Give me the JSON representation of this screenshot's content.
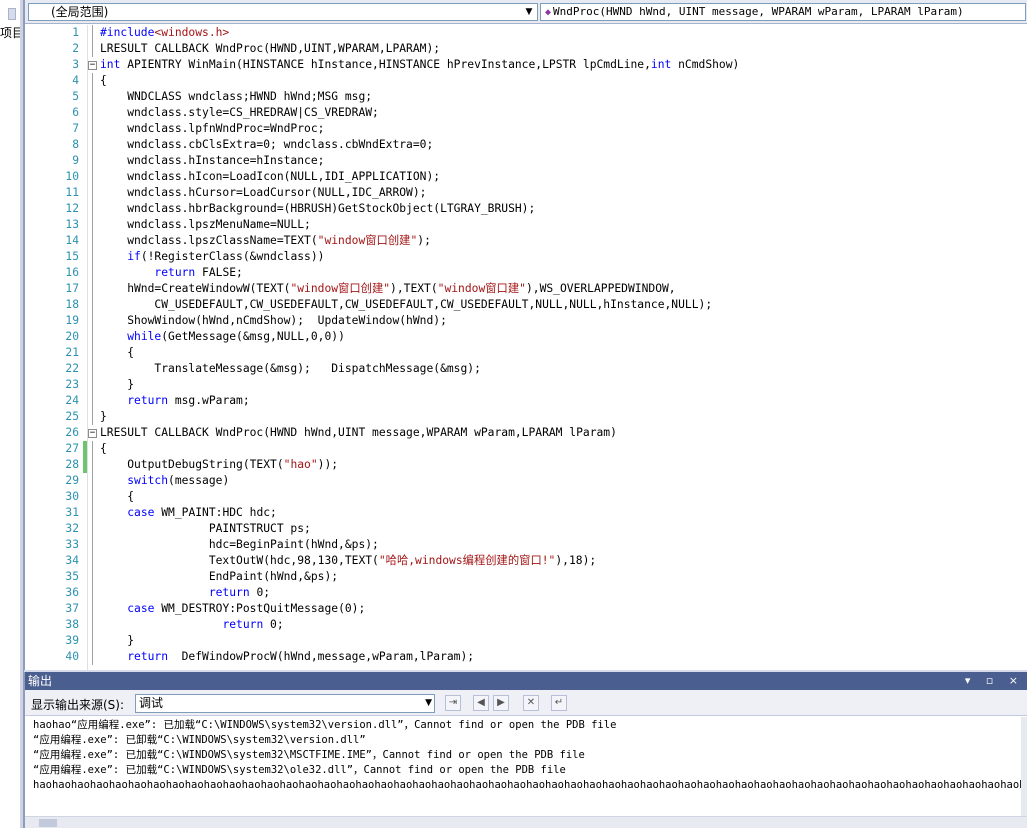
{
  "left_panel": {
    "project_label": "项目"
  },
  "editor": {
    "scope_combo": "(全局范围)",
    "member_combo": "WndProc(HWND hWnd, UINT message, WPARAM wParam, LPARAM lParam)",
    "lines": [
      {
        "n": "1",
        "parts": [
          {
            "t": "#include",
            "c": "pp"
          },
          {
            "t": "<windows.h>",
            "c": "str"
          }
        ]
      },
      {
        "n": "2",
        "parts": [
          {
            "t": "LRESULT CALLBACK WndProc(HWND,UINT,WPARAM,LPARAM);"
          }
        ]
      },
      {
        "n": "3",
        "fold": "minus",
        "parts": [
          {
            "t": "int",
            "c": "kw"
          },
          {
            "t": " APIENTRY WinMain(HINSTANCE hInstance,HINSTANCE hPrevInstance,LPSTR lpCmdLine,"
          },
          {
            "t": "int",
            "c": "kw"
          },
          {
            "t": " nCmdShow)"
          }
        ]
      },
      {
        "n": "4",
        "parts": [
          {
            "t": "{"
          }
        ]
      },
      {
        "n": "5",
        "parts": [
          {
            "t": "    WNDCLASS wndclass;HWND hWnd;MSG msg;"
          }
        ]
      },
      {
        "n": "6",
        "parts": [
          {
            "t": "    wndclass.style=CS_HREDRAW|CS_VREDRAW;"
          }
        ]
      },
      {
        "n": "7",
        "parts": [
          {
            "t": "    wndclass.lpfnWndProc=WndProc;"
          }
        ]
      },
      {
        "n": "8",
        "parts": [
          {
            "t": "    wndclass.cbClsExtra=0; wndclass.cbWndExtra=0;"
          }
        ]
      },
      {
        "n": "9",
        "parts": [
          {
            "t": "    wndclass.hInstance=hInstance;"
          }
        ]
      },
      {
        "n": "10",
        "parts": [
          {
            "t": "    wndclass.hIcon=LoadIcon(NULL,IDI_APPLICATION);"
          }
        ]
      },
      {
        "n": "11",
        "parts": [
          {
            "t": "    wndclass.hCursor=LoadCursor(NULL,IDC_ARROW);"
          }
        ]
      },
      {
        "n": "12",
        "parts": [
          {
            "t": "    wndclass.hbrBackground=(HBRUSH)GetStockObject(LTGRAY_BRUSH);"
          }
        ]
      },
      {
        "n": "13",
        "parts": [
          {
            "t": "    wndclass.lpszMenuName=NULL;"
          }
        ]
      },
      {
        "n": "14",
        "parts": [
          {
            "t": "    wndclass.lpszClassName=TEXT("
          },
          {
            "t": "\"window窗口创建\"",
            "c": "str"
          },
          {
            "t": ");"
          }
        ]
      },
      {
        "n": "15",
        "parts": [
          {
            "t": "    "
          },
          {
            "t": "if",
            "c": "kw"
          },
          {
            "t": "(!RegisterClass(&wndclass))"
          }
        ]
      },
      {
        "n": "16",
        "parts": [
          {
            "t": "        "
          },
          {
            "t": "return",
            "c": "kw"
          },
          {
            "t": " FALSE;"
          }
        ]
      },
      {
        "n": "17",
        "parts": [
          {
            "t": "    hWnd=CreateWindowW(TEXT("
          },
          {
            "t": "\"window窗口创建\"",
            "c": "str"
          },
          {
            "t": "),TEXT("
          },
          {
            "t": "\"window窗口建\"",
            "c": "str"
          },
          {
            "t": "),WS_OVERLAPPEDWINDOW,"
          }
        ]
      },
      {
        "n": "18",
        "parts": [
          {
            "t": "        CW_USEDEFAULT,CW_USEDEFAULT,CW_USEDEFAULT,CW_USEDEFAULT,NULL,NULL,hInstance,NULL);"
          }
        ]
      },
      {
        "n": "19",
        "parts": [
          {
            "t": "    ShowWindow(hWnd,nCmdShow);  UpdateWindow(hWnd);"
          }
        ]
      },
      {
        "n": "20",
        "parts": [
          {
            "t": "    "
          },
          {
            "t": "while",
            "c": "kw"
          },
          {
            "t": "(GetMessage(&msg,NULL,0,0))"
          }
        ]
      },
      {
        "n": "21",
        "parts": [
          {
            "t": "    {"
          }
        ]
      },
      {
        "n": "22",
        "parts": [
          {
            "t": "        TranslateMessage(&msg);   DispatchMessage(&msg);"
          }
        ]
      },
      {
        "n": "23",
        "parts": [
          {
            "t": "    }"
          }
        ]
      },
      {
        "n": "24",
        "parts": [
          {
            "t": "    "
          },
          {
            "t": "return",
            "c": "kw"
          },
          {
            "t": " msg.wParam;"
          }
        ]
      },
      {
        "n": "25",
        "parts": [
          {
            "t": "}"
          }
        ]
      },
      {
        "n": "26",
        "fold": "minus",
        "parts": [
          {
            "t": "LRESULT CALLBACK WndProc(HWND hWnd,UINT message,WPARAM wParam,LPARAM lParam)"
          }
        ]
      },
      {
        "n": "27",
        "chg": "green",
        "parts": [
          {
            "t": "{"
          }
        ]
      },
      {
        "n": "28",
        "chg": "green",
        "parts": [
          {
            "t": "    OutputDebugString(TEXT("
          },
          {
            "t": "\"hao\"",
            "c": "str"
          },
          {
            "t": "));"
          }
        ]
      },
      {
        "n": "29",
        "parts": [
          {
            "t": "    "
          },
          {
            "t": "switch",
            "c": "kw"
          },
          {
            "t": "(message)"
          }
        ]
      },
      {
        "n": "30",
        "parts": [
          {
            "t": "    {"
          }
        ]
      },
      {
        "n": "31",
        "parts": [
          {
            "t": "    "
          },
          {
            "t": "case",
            "c": "kw"
          },
          {
            "t": " WM_PAINT:HDC hdc;"
          }
        ]
      },
      {
        "n": "32",
        "parts": [
          {
            "t": "                PAINTSTRUCT ps;"
          }
        ]
      },
      {
        "n": "33",
        "parts": [
          {
            "t": "                hdc=BeginPaint(hWnd,&ps);"
          }
        ]
      },
      {
        "n": "34",
        "parts": [
          {
            "t": "                TextOutW(hdc,98,130,TEXT("
          },
          {
            "t": "\"哈哈,windows编程创建的窗口!\"",
            "c": "str"
          },
          {
            "t": "),18);"
          }
        ]
      },
      {
        "n": "35",
        "parts": [
          {
            "t": "                EndPaint(hWnd,&ps);"
          }
        ]
      },
      {
        "n": "36",
        "parts": [
          {
            "t": "                "
          },
          {
            "t": "return",
            "c": "kw"
          },
          {
            "t": " 0;"
          }
        ]
      },
      {
        "n": "37",
        "parts": [
          {
            "t": "    "
          },
          {
            "t": "case",
            "c": "kw"
          },
          {
            "t": " WM_DESTROY:PostQuitMessage(0);"
          }
        ]
      },
      {
        "n": "38",
        "parts": [
          {
            "t": "                  "
          },
          {
            "t": "return",
            "c": "kw"
          },
          {
            "t": " 0;"
          }
        ]
      },
      {
        "n": "39",
        "parts": [
          {
            "t": "    }"
          }
        ]
      },
      {
        "n": "40",
        "parts": [
          {
            "t": "    "
          },
          {
            "t": "return",
            "c": "kw"
          },
          {
            "t": "  DefWindowProcW(hWnd,message,wParam,lParam);"
          }
        ]
      }
    ]
  },
  "output": {
    "title": "输出",
    "title_controls": "▾ ▫ ×",
    "source_label": "显示输出来源(S):",
    "source_value": "调试",
    "lines": [
      "haohao“应用编程.exe”: 已加载“C:\\WINDOWS\\system32\\version.dll”，Cannot find or open the PDB file",
      "“应用编程.exe”: 已卸载“C:\\WINDOWS\\system32\\version.dll”",
      "“应用编程.exe”: 已加载“C:\\WINDOWS\\system32\\MSCTFIME.IME”，Cannot find or open the PDB file",
      "“应用编程.exe”: 已加载“C:\\WINDOWS\\system32\\ole32.dll”，Cannot find or open the PDB file",
      "haohaohaohaohaohaohaohaohaohaohaohaohaohaohaohaohaohaohaohaohaohaohaohaohaohaohaohaohaohaohaohaohaohaohaohaohaohaohaohaohaohaohaohaohaohaohaohaohaohaohaohaohaohaohaohaohaohaohaohaohaohaohaohaohaohaohaohaohaohaohaohaohaohaohaohaohaohaohaohaohaohaohaohaohaohao"
    ]
  }
}
